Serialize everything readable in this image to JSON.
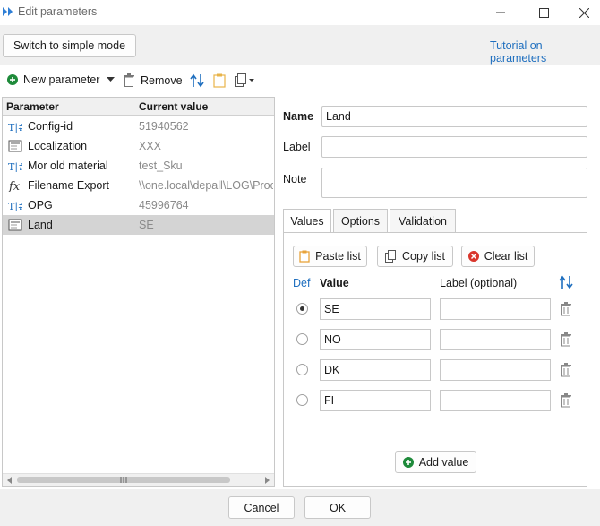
{
  "window": {
    "title": "Edit parameters"
  },
  "header": {
    "simple_mode_button": "Switch to simple mode",
    "tutorial_link": "Tutorial on parameters"
  },
  "left_toolbar": {
    "new_parameter": "New parameter",
    "remove": "Remove"
  },
  "param_list": {
    "columns": [
      "Parameter",
      "Current value"
    ],
    "rows": [
      {
        "name": "Config-id",
        "value": "51940562",
        "icon": "text-number-icon"
      },
      {
        "name": "Localization",
        "value": "XXX",
        "icon": "list-icon"
      },
      {
        "name": "Mor old material",
        "value": "test_Sku",
        "icon": "text-number-icon"
      },
      {
        "name": "Filename Export",
        "value": "\\\\one.local\\depall\\LOG\\Proc",
        "icon": "function-icon"
      },
      {
        "name": "OPG",
        "value": "45996764",
        "icon": "text-number-icon"
      },
      {
        "name": "Land",
        "value": "SE",
        "icon": "list-icon",
        "selected": true
      }
    ]
  },
  "details": {
    "name_label": "Name",
    "name_value": "Land",
    "label_label": "Label",
    "label_value": "",
    "note_label": "Note",
    "note_value": ""
  },
  "tabs": [
    "Values",
    "Options",
    "Validation"
  ],
  "values_panel": {
    "paste_list": "Paste list",
    "copy_list": "Copy list",
    "clear_list": "Clear list",
    "col_def": "Def",
    "col_value": "Value",
    "col_label": "Label (optional)",
    "rows": [
      {
        "value": "SE",
        "label": "",
        "default": true
      },
      {
        "value": "NO",
        "label": "",
        "default": false
      },
      {
        "value": "DK",
        "label": "",
        "default": false
      },
      {
        "value": "FI",
        "label": "",
        "default": false
      }
    ],
    "add_value": "Add value"
  },
  "footer": {
    "cancel": "Cancel",
    "ok": "OK"
  },
  "colors": {
    "accent_link": "#1f6fbf",
    "add_green": "#1e8a3a",
    "clear_red": "#d9362c",
    "selected_row": "#d4d4d4"
  }
}
